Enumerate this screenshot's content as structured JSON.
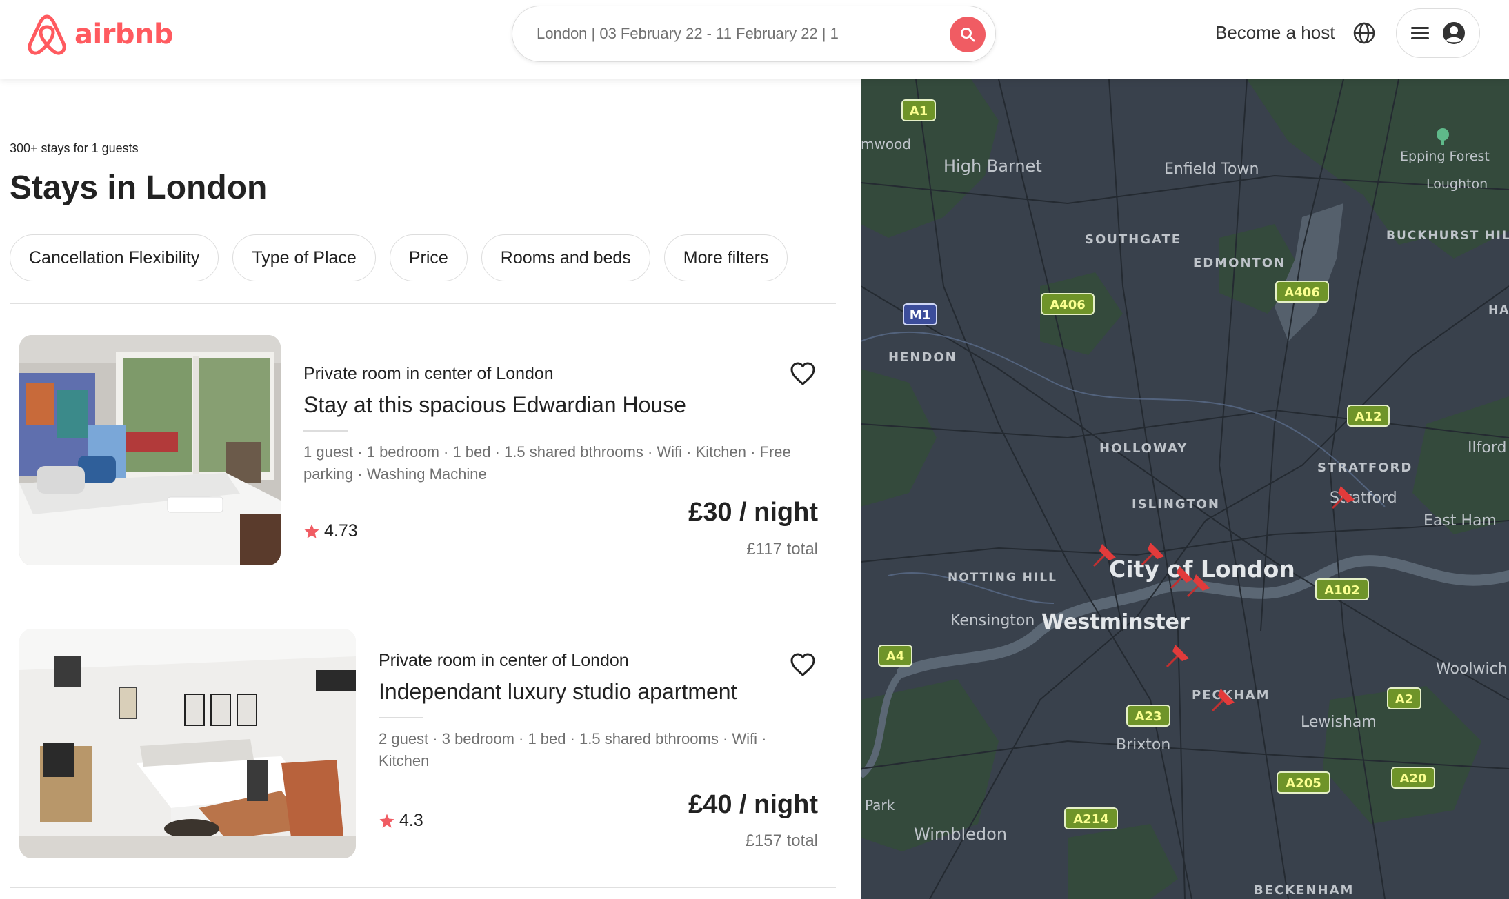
{
  "header": {
    "brand": "airbnb",
    "search_text": "London | 03 February 22 - 11 February 22 | 1",
    "become_host": "Become a host"
  },
  "results": {
    "count_text": "300+ stays for 1 guests",
    "title": "Stays in London"
  },
  "filters": [
    "Cancellation Flexibility",
    "Type of Place",
    "Price",
    "Rooms and beds",
    "More filters"
  ],
  "listings": [
    {
      "subtitle": "Private room in center of London",
      "title": "Stay at this spacious Edwardian House",
      "amenities": "1 guest · 1 bedroom · 1 bed · 1.5 shared bthrooms · Wifi · Kitchen · Free parking · Washing Machine",
      "rating": "4.73",
      "price": "£30 / night",
      "total": "£117 total"
    },
    {
      "subtitle": "Private room in center of London",
      "title": "Independant luxury studio apartment",
      "amenities": "2 guest · 3 bedroom · 1 bed · 1.5 shared bthrooms · Wifi · Kitchen",
      "rating": "4.3",
      "price": "£40 / night",
      "total": "£157 total"
    }
  ],
  "map": {
    "places": {
      "high_barnet": "High Barnet",
      "enfield_town": "Enfield Town",
      "epping_forest": "Epping Forest",
      "loughton": "Loughton",
      "southgate": "SOUTHGATE",
      "edmonton": "EDMONTON",
      "buckhurst_hill": "BUCKHURST HILL",
      "hendon": "HENDON",
      "holloway": "HOLLOWAY",
      "stratford_caps": "STRATFORD",
      "stratford": "Stratford",
      "ilford": "Ilford",
      "islington": "ISLINGTON",
      "east_ham": "East Ham",
      "city_of_london": "City of London",
      "notting_hill": "NOTTING HILL",
      "kensington": "Kensington",
      "westminster": "Westminster",
      "woolwich": "Woolwich",
      "peckham": "PECKHAM",
      "lewisham": "Lewisham",
      "brixton": "Brixton",
      "wimbledon": "Wimbledon",
      "beckenham": "BECKENHAM",
      "park_partial": "Park",
      "mwood_partial": "mwood",
      "hai_partial": "HAI"
    },
    "roads": [
      "A1",
      "M1",
      "A406",
      "A406",
      "A12",
      "A102",
      "A4",
      "A2",
      "A23",
      "A205",
      "A20",
      "A214"
    ],
    "pins_count": 8
  },
  "colors": {
    "brand": "#FF5A5F",
    "search_button": "#F05C63",
    "map_base": "#39414c",
    "map_green": "#344a3c",
    "road_badge": "#7b9e2a",
    "motorway_badge": "#3c4d9b"
  }
}
